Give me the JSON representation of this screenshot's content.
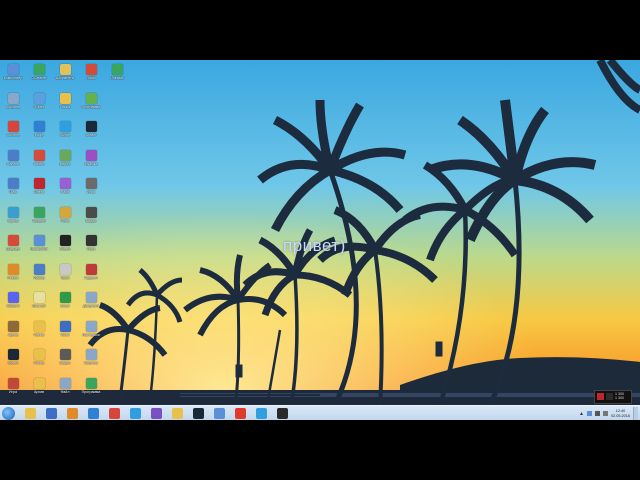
{
  "desktop": {
    "overlay_text": "привет)",
    "icons": [
      {
        "label": "Компьютер",
        "color": "#5b8fd6",
        "col": 0,
        "row": 0
      },
      {
        "label": "CCleaner",
        "color": "#3aa55d",
        "col": 1,
        "row": 0
      },
      {
        "label": "Документы",
        "color": "#e1c15c",
        "col": 2,
        "row": 0
      },
      {
        "label": "Gmail",
        "color": "#d64a3a",
        "col": 3,
        "row": 0
      },
      {
        "label": "Uninstall",
        "color": "#3aa55d",
        "col": 4,
        "row": 0
      },
      {
        "label": "Корзина",
        "color": "#8aa6c8",
        "col": 0,
        "row": 1
      },
      {
        "label": "iTunes",
        "color": "#5aa0e0",
        "col": 1,
        "row": 1
      },
      {
        "label": "Папка",
        "color": "#e8c04a",
        "col": 2,
        "row": 1
      },
      {
        "label": "Программа",
        "color": "#63b34a",
        "col": 3,
        "row": 1
      },
      {
        "label": "Chrome",
        "color": "#d8453a",
        "col": 0,
        "row": 2
      },
      {
        "label": "Edge",
        "color": "#2f7fd4",
        "col": 1,
        "row": 2
      },
      {
        "label": "Skype",
        "color": "#2f9fe0",
        "col": 2,
        "row": 2
      },
      {
        "label": "Steam",
        "color": "#1b2838",
        "col": 3,
        "row": 2
      },
      {
        "label": "Панель",
        "color": "#4a7ec9",
        "col": 0,
        "row": 3
      },
      {
        "label": "Adobe",
        "color": "#d84b3b",
        "col": 1,
        "row": 3
      },
      {
        "label": "Видео",
        "color": "#6aa85a",
        "col": 2,
        "row": 3
      },
      {
        "label": "Музыка",
        "color": "#9b4fc2",
        "col": 3,
        "row": 3
      },
      {
        "label": "Пуск",
        "color": "#4a7ec9",
        "col": 0,
        "row": 4
      },
      {
        "label": "Opera",
        "color": "#c0262d",
        "col": 1,
        "row": 4
      },
      {
        "label": "Paint",
        "color": "#9a5fd0",
        "col": 2,
        "row": 4
      },
      {
        "label": "Игра",
        "color": "#6b6b6b",
        "col": 3,
        "row": 4
      },
      {
        "label": "Карты",
        "color": "#3a9fd0",
        "col": 0,
        "row": 5
      },
      {
        "label": "Торрент",
        "color": "#3aa55d",
        "col": 1,
        "row": 5
      },
      {
        "label": "Фото",
        "color": "#d6a63a",
        "col": 2,
        "row": 5
      },
      {
        "label": "Видео",
        "color": "#4b4b4b",
        "col": 3,
        "row": 5
      },
      {
        "label": "Браузер",
        "color": "#d64a3a",
        "col": 0,
        "row": 6
      },
      {
        "label": "Настройки",
        "color": "#5b8fd6",
        "col": 1,
        "row": 6
      },
      {
        "label": "Steam",
        "color": "#222",
        "col": 2,
        "row": 6
      },
      {
        "label": "Игра",
        "color": "#333",
        "col": 3,
        "row": 6
      },
      {
        "label": "Firefox",
        "color": "#e08a2a",
        "col": 0,
        "row": 7
      },
      {
        "label": "Файлы",
        "color": "#4a7ec9",
        "col": 1,
        "row": 7
      },
      {
        "label": "Текст",
        "color": "#c8c8c8",
        "col": 2,
        "row": 7
      },
      {
        "label": "Торрент",
        "color": "#c03a3a",
        "col": 3,
        "row": 7
      },
      {
        "label": "Discord",
        "color": "#5865f2",
        "col": 0,
        "row": 8
      },
      {
        "label": "Блокнот",
        "color": "#e8e0a0",
        "col": 1,
        "row": 8
      },
      {
        "label": "Excel",
        "color": "#2f9b4a",
        "col": 2,
        "row": 8
      },
      {
        "label": "Документ",
        "color": "#8aa6c8",
        "col": 3,
        "row": 8
      },
      {
        "label": "Архив",
        "color": "#8e6a3a",
        "col": 0,
        "row": 9
      },
      {
        "label": "Папка",
        "color": "#e8c04a",
        "col": 1,
        "row": 9
      },
      {
        "label": "Word",
        "color": "#3c6fc4",
        "col": 2,
        "row": 9
      },
      {
        "label": "Настройки",
        "color": "#8aa6c8",
        "col": 3,
        "row": 9
      },
      {
        "label": "Steam",
        "color": "#1b2838",
        "col": 0,
        "row": 10
      },
      {
        "label": "Папка",
        "color": "#e8c04a",
        "col": 1,
        "row": 10
      },
      {
        "label": "Видео",
        "color": "#5a5a5a",
        "col": 2,
        "row": 10
      },
      {
        "label": "Корзина",
        "color": "#8aa6c8",
        "col": 3,
        "row": 10
      },
      {
        "label": "Игра",
        "color": "#c04a3a",
        "col": 0,
        "row": 11
      },
      {
        "label": "Архив",
        "color": "#e8c04a",
        "col": 1,
        "row": 11
      },
      {
        "label": "Файл",
        "color": "#8aa6c8",
        "col": 2,
        "row": 11
      },
      {
        "label": "Программа",
        "color": "#3aa55d",
        "col": 3,
        "row": 11
      }
    ]
  },
  "taskbar": {
    "pinned": [
      {
        "name": "explorer-icon",
        "color": "#e8c04a"
      },
      {
        "name": "word-icon",
        "color": "#3c6fc4"
      },
      {
        "name": "media-player-icon",
        "color": "#e08a2a"
      },
      {
        "name": "ie-icon",
        "color": "#2f7fd4"
      },
      {
        "name": "chrome-icon",
        "color": "#d8453a"
      },
      {
        "name": "skype-icon",
        "color": "#2f9fe0"
      },
      {
        "name": "visual-studio-icon",
        "color": "#7a4fc2"
      },
      {
        "name": "folder-icon",
        "color": "#e8c04a"
      },
      {
        "name": "steam-icon",
        "color": "#1b2838"
      },
      {
        "name": "game-icon",
        "color": "#5b8fd6"
      },
      {
        "name": "yandex-icon",
        "color": "#e03a2a"
      },
      {
        "name": "skype-icon",
        "color": "#2f9fe0"
      },
      {
        "name": "obs-icon",
        "color": "#2a2a2a"
      }
    ],
    "clock_time": "12:40",
    "clock_date": "02.05.2016"
  },
  "widget": {
    "line1": "1 300",
    "line2": "1 300"
  }
}
